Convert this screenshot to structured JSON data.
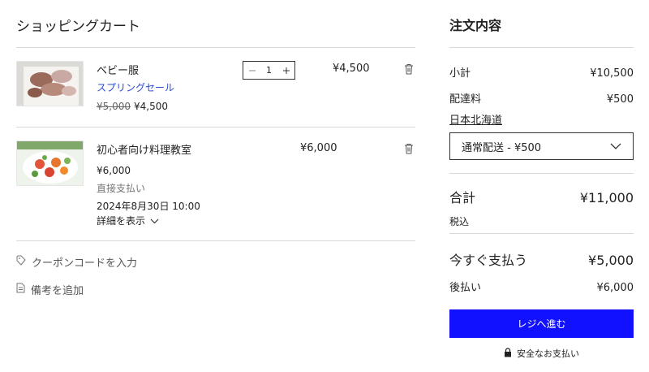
{
  "cart": {
    "title": "ショッピングカート",
    "items": [
      {
        "name": "ベビー服",
        "sale_label": "スプリングセール",
        "original_price": "¥5,000",
        "price": "¥4,500",
        "quantity": "1",
        "line_total": "¥4,500"
      },
      {
        "name": "初心者向け料理教室",
        "price": "¥6,000",
        "payment_note": "直接支払い",
        "datetime": "2024年8月30日 10:00",
        "details_label": "詳細を表示",
        "line_total": "¥6,000"
      }
    ],
    "coupon_label": "クーポンコードを入力",
    "note_label": "備考を追加"
  },
  "summary": {
    "title": "注文内容",
    "subtotal_label": "小計",
    "subtotal_value": "¥10,500",
    "shipping_label": "配達料",
    "shipping_value": "¥500",
    "region_link": "日本北海道",
    "shipping_option": "通常配送 - ¥500",
    "total_label": "合計",
    "total_value": "¥11,000",
    "tax_note": "税込",
    "pay_now_label": "今すぐ支払う",
    "pay_now_value": "¥5,000",
    "pay_later_label": "後払い",
    "pay_later_value": "¥6,000",
    "checkout_label": "レジへ進む",
    "secure_label": "安全なお支払い"
  },
  "colors": {
    "accent": "#1111ff",
    "link": "#2a4ad3",
    "divider": "#d9d9d9"
  },
  "icons": [
    "minus-icon",
    "plus-icon",
    "trash-icon",
    "chevron-down-icon",
    "tag-icon",
    "note-icon",
    "lock-icon"
  ]
}
